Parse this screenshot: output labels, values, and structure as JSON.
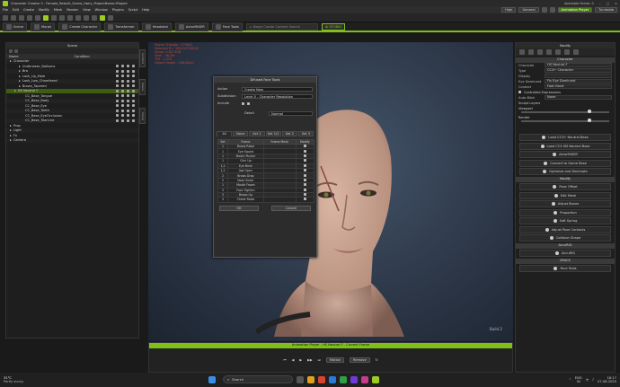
{
  "app": {
    "title": "Character Creator 3 - Female_Rebuilt_Scene_Hairy_ProjectName.iProject",
    "user": "Available Points: 0"
  },
  "menu": [
    "File",
    "Edit",
    "Create",
    "Modify",
    "Mesh",
    "Render",
    "View",
    "Window",
    "Plugins",
    "Script",
    "Help"
  ],
  "menu_right": {
    "quality": "High",
    "render": "General",
    "anim_player": "Animation Player",
    "turntable": "Turntable"
  },
  "toolbar": {
    "tabs": [
      "Scene",
      "Morph",
      "Create Character",
      "Transformer",
      "Headshot",
      "ActorMIXER",
      "Face Tools"
    ],
    "search_placeholder": "Begin Create Content Search",
    "ai": "AI STUDIO"
  },
  "scene": {
    "title": "Scene",
    "col_name": "Name",
    "col_cond": "Condition",
    "items": [
      {
        "label": "Character",
        "indent": 0
      },
      {
        "label": "Underwear_Bottoms",
        "indent": 2
      },
      {
        "label": "Bra",
        "indent": 2
      },
      {
        "label": "Lash_Up_Male",
        "indent": 2
      },
      {
        "label": "Lash_Low_Chamfered",
        "indent": 2
      },
      {
        "label": "Brows_Tapered",
        "indent": 2
      },
      {
        "label": "HS Neutral F",
        "indent": 1,
        "sel": true
      },
      {
        "label": "CC_Base_Tongue",
        "indent": 3
      },
      {
        "label": "CC_Base_Body",
        "indent": 3
      },
      {
        "label": "CC_Base_Eye",
        "indent": 3
      },
      {
        "label": "CC_Base_Teeth",
        "indent": 3
      },
      {
        "label": "CC_Base_EyeOcclusion",
        "indent": 3
      },
      {
        "label": "CC_Base_TearLine",
        "indent": 3
      },
      {
        "label": "Prop",
        "indent": 0
      },
      {
        "label": "Light",
        "indent": 0
      },
      {
        "label": "Fx",
        "indent": 0
      },
      {
        "label": "Camera",
        "indent": 0
      }
    ]
  },
  "sidetabs": [
    "Content",
    "Scene",
    "Visual"
  ],
  "stats": [
    "Project Triangle : 379832",
    "Selected Tri : 33015(578832)",
    "Visual: 5.8/7.5GB",
    "Shell : 28.2M",
    "TFS : 1.07K",
    "Object Height : 166.08cm"
  ],
  "dialog": {
    "title": "Difused Face Tools",
    "action_label": "Action",
    "action_value": "Create New",
    "subdivision_label": "Subdivision",
    "subdivision_value": "Level 0 - Character Resolution",
    "include_label": "Include",
    "detail_label": "Detail",
    "detail_value": "Normal",
    "tabs": [
      "All",
      "None",
      "Set 1",
      "Set 1/2",
      "Set 2",
      "Set 3"
    ],
    "cols": [
      "Set",
      "Frame",
      "Frame Mesh",
      "Modify"
    ],
    "rows": [
      {
        "set": "1",
        "frame": "Brows Raise"
      },
      {
        "set": "1",
        "frame": "Eye Squint"
      },
      {
        "set": "1",
        "frame": "Mouth Pucker"
      },
      {
        "set": "1",
        "frame": "Chin Up"
      },
      {
        "set": "1,2",
        "frame": "Eye Blink"
      },
      {
        "set": "1,2",
        "frame": "Jaw Open"
      },
      {
        "set": "2",
        "frame": "Brows Drop"
      },
      {
        "set": "2",
        "frame": "Nose Sneer"
      },
      {
        "set": "1",
        "frame": "Mouth Frown"
      },
      {
        "set": "3",
        "frame": "Face Tighten"
      },
      {
        "set": "3",
        "frame": "Brows Up"
      },
      {
        "set": "3",
        "frame": "Cheek Raise"
      }
    ],
    "ok": "OK",
    "cancel": "Cancel"
  },
  "modify": {
    "title": "Modify",
    "sec_character": "Character",
    "props": [
      {
        "label": "Character",
        "value": "HS Neutral F"
      },
      {
        "label": "Type",
        "value": "CC3+ Character"
      },
      {
        "label": "Display",
        "value": ""
      },
      {
        "label": "Eye Dominant",
        "value": "Fix Eye Dominant"
      },
      {
        "label": "Contact",
        "value": "Foot   Hand"
      }
    ],
    "controlled": "Controlled Expressions",
    "auto_blink": "Auto Blink",
    "auto_blink_val": "None",
    "sculpt": "Sculpt Layers",
    "viewport": "Viewport",
    "render": "Render",
    "btns1": [
      "Load CC3+ Neutral Base",
      "Load CC3 HD Neutral Base",
      "ActorMIXER",
      "Convert to Game Base",
      "Optimize and Decimate"
    ],
    "sec_modify": "Modify",
    "btns2": [
      "Pose Offset",
      "Edit Mesh",
      "Adjust Bones",
      "Proportion",
      "Soft Spring",
      "Adjust Pose Contacts",
      "Collision Shape"
    ],
    "sec_accurig": "AccuRIG",
    "accurig": "AccuRIG",
    "sec_dfacs": "DFACS",
    "facetools": "Face Tools"
  },
  "anim": {
    "title": "Animation Player - HS Neutral F - Current Frame",
    "motion": "Motion",
    "remove": "Remove"
  },
  "viewport_tag": "Build 2",
  "taskbar": {
    "weather_temp": "31°C",
    "weather_desc": "Partly sunny",
    "search": "Search",
    "lang1": "ENG",
    "lang2": "IN",
    "time": "18:17",
    "date": "07-08-2025"
  },
  "colors": {
    "accent": "#7fbf1a",
    "stats": "#c24a3a"
  }
}
